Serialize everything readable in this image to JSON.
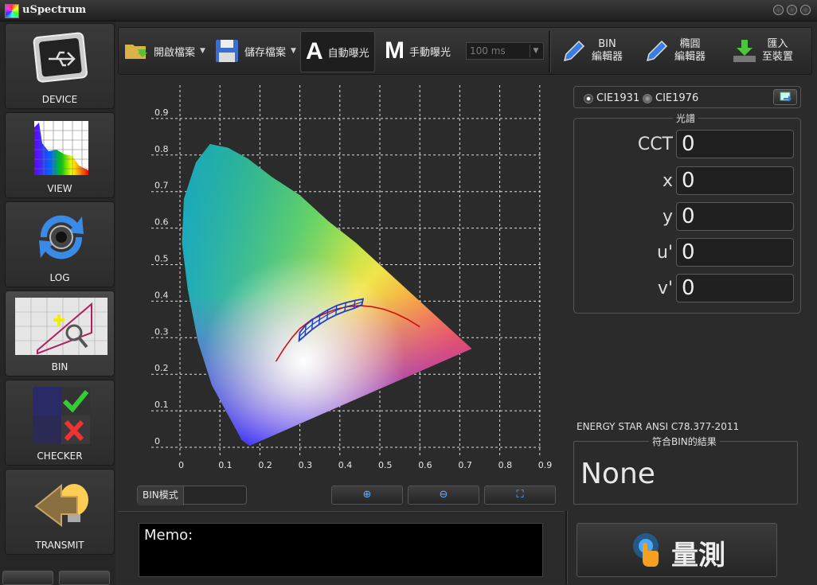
{
  "window": {
    "title": "uSpectrum"
  },
  "sidebar": {
    "items": [
      {
        "label": "DEVICE",
        "icon": "usb-icon"
      },
      {
        "label": "VIEW",
        "icon": "spectrum-graph-icon"
      },
      {
        "label": "LOG",
        "icon": "refresh-camera-icon"
      },
      {
        "label": "BIN",
        "icon": "bin-chart-zoom-icon"
      },
      {
        "label": "CHECKER",
        "icon": "check-cross-icon"
      },
      {
        "label": "TRANSMIT",
        "icon": "transmit-bulb-icon"
      }
    ],
    "active": "BIN"
  },
  "toolbar": {
    "open_label": "開啟檔案",
    "save_label": "儲存檔案",
    "auto_exposure_label": "自動曝光",
    "manual_exposure_label": "手動曝光",
    "exposure_value": "100 ms",
    "bin_editor_line1": "BIN",
    "bin_editor_line2": "編輯器",
    "ellipse_editor_line1": "橢圓",
    "ellipse_editor_line2": "編輯器",
    "import_line1": "匯入",
    "import_line2": "至裝置"
  },
  "cie": {
    "option1": "CIE1931",
    "option2": "CIE1976",
    "selected": "CIE1931"
  },
  "spectrum": {
    "legend": "光譜",
    "rows": [
      {
        "label": "CCT",
        "value": "0"
      },
      {
        "label": "x",
        "value": "0"
      },
      {
        "label": "y",
        "value": "0"
      },
      {
        "label": "u'",
        "value": "0"
      },
      {
        "label": "v'",
        "value": "0"
      }
    ]
  },
  "energy_star": "ENERGY STAR ANSI C78.377-2011",
  "bin_result": {
    "legend": "符合BIN的結果",
    "value": "None"
  },
  "chart_footer": {
    "bin_mode_label": "BIN模式"
  },
  "memo": {
    "label": "Memo:"
  },
  "measure": {
    "label": "量測"
  },
  "chart_data": {
    "type": "scatter",
    "title": "",
    "xlabel": "",
    "ylabel": "",
    "xlim": [
      0,
      0.9
    ],
    "ylim": [
      0,
      0.9
    ],
    "x_ticks": [
      "0",
      "0.1",
      "0.2",
      "0.3",
      "0.4",
      "0.5",
      "0.6",
      "0.7",
      "0.8",
      "0.9"
    ],
    "y_ticks": [
      "0",
      "0.1",
      "0.2",
      "0.3",
      "0.4",
      "0.5",
      "0.6",
      "0.7",
      "0.8",
      "0.9"
    ],
    "grid": true,
    "series": [
      {
        "x": [
          0.175,
          0.17,
          0.155,
          0.14,
          0.115,
          0.08,
          0.045,
          0.02,
          0.005,
          0.01,
          0.04,
          0.075,
          0.12,
          0.17,
          0.23,
          0.3,
          0.37,
          0.44,
          0.51,
          0.58,
          0.64,
          0.69,
          0.73,
          0.175
        ],
        "y": [
          0.005,
          0.008,
          0.02,
          0.05,
          0.1,
          0.17,
          0.29,
          0.43,
          0.56,
          0.68,
          0.78,
          0.83,
          0.82,
          0.79,
          0.74,
          0.69,
          0.62,
          0.56,
          0.49,
          0.42,
          0.36,
          0.31,
          0.27,
          0.005
        ]
      },
      {
        "x": [
          0.24,
          0.26,
          0.28,
          0.3,
          0.33,
          0.36,
          0.39,
          0.42,
          0.45,
          0.48,
          0.51,
          0.54,
          0.57,
          0.6
        ],
        "y": [
          0.235,
          0.27,
          0.3,
          0.325,
          0.35,
          0.365,
          0.378,
          0.385,
          0.388,
          0.385,
          0.378,
          0.366,
          0.35,
          0.33
        ]
      },
      {
        "x": [
          0.3,
          0.315,
          0.332,
          0.35,
          0.37,
          0.392,
          0.415,
          0.438,
          0.458,
          0.455,
          0.435,
          0.412,
          0.39,
          0.368,
          0.348,
          0.33,
          0.313,
          0.298,
          0.3
        ],
        "y": [
          0.315,
          0.335,
          0.35,
          0.363,
          0.376,
          0.388,
          0.396,
          0.402,
          0.406,
          0.39,
          0.38,
          0.372,
          0.362,
          0.35,
          0.336,
          0.322,
          0.306,
          0.292,
          0.315
        ]
      }
    ]
  }
}
